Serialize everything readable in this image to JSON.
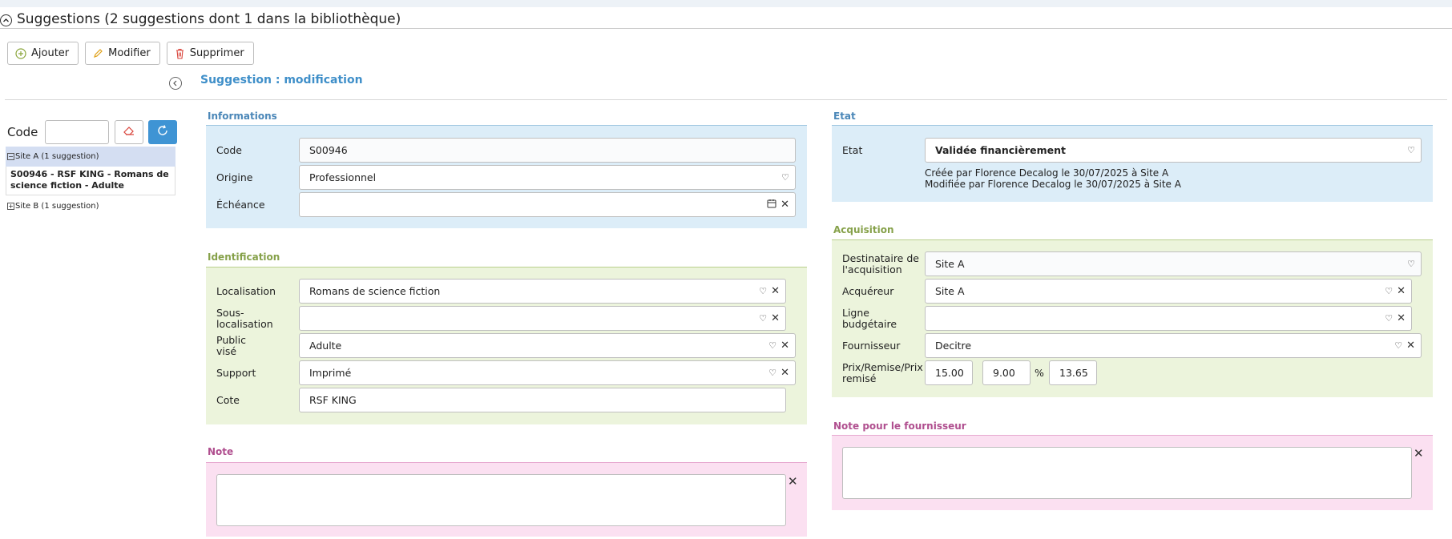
{
  "panel": {
    "title": "Suggestions (2 suggestions dont 1 dans la bibliothèque)"
  },
  "toolbar": {
    "add": "Ajouter",
    "edit": "Modifier",
    "delete": "Supprimer"
  },
  "form_title": "Suggestion : modification",
  "sidebar": {
    "code_label": "Code",
    "code_value": "",
    "groups": [
      {
        "label": "Site A (1 suggestion)",
        "items": [
          "S00946 - RSF KING - Romans de science fiction - Adulte"
        ]
      },
      {
        "label": "Site B (1 suggestion)",
        "items": []
      }
    ]
  },
  "informations": {
    "title": "Informations",
    "code_label": "Code",
    "code_value": "S00946",
    "origine_label": "Origine",
    "origine_value": "Professionnel",
    "echeance_label": "Échéance",
    "echeance_value": ""
  },
  "identification": {
    "title": "Identification",
    "localisation_label": "Localisation",
    "localisation_value": "Romans de science fiction",
    "souslocalisation_label": "Sous-localisation",
    "souslocalisation_value": "",
    "public_label": "Public visé",
    "public_value": "Adulte",
    "support_label": "Support",
    "support_value": "Imprimé",
    "cote_label": "Cote",
    "cote_value": "RSF KING"
  },
  "note": {
    "title": "Note",
    "value": ""
  },
  "etat": {
    "title": "Etat",
    "etat_label": "Etat",
    "etat_value": "Validée financièrement",
    "created": "Créée par Florence Decalog le 30/07/2025 à Site A",
    "modified": "Modifiée par Florence Decalog le 30/07/2025 à Site A"
  },
  "acquisition": {
    "title": "Acquisition",
    "destinataire_label": "Destinataire de l'acquisition",
    "destinataire_value": "Site A",
    "acquereur_label": "Acquéreur",
    "acquereur_value": "Site A",
    "ligne_label": "Ligne budgétaire",
    "ligne_value": "",
    "fournisseur_label": "Fournisseur",
    "fournisseur_value": "Decitre",
    "prix_label": "Prix/Remise/Prix remisé",
    "prix": "15.00",
    "remise": "9.00",
    "percent": "%",
    "prix_remise": "13.65"
  },
  "note_fournisseur": {
    "title": "Note pour le fournisseur",
    "value": ""
  },
  "colors": {
    "accent": "#3f94d4",
    "blue_section": "#dcedf8",
    "green_section": "#ecf4dc",
    "pink_section": "#fbe0f1"
  }
}
